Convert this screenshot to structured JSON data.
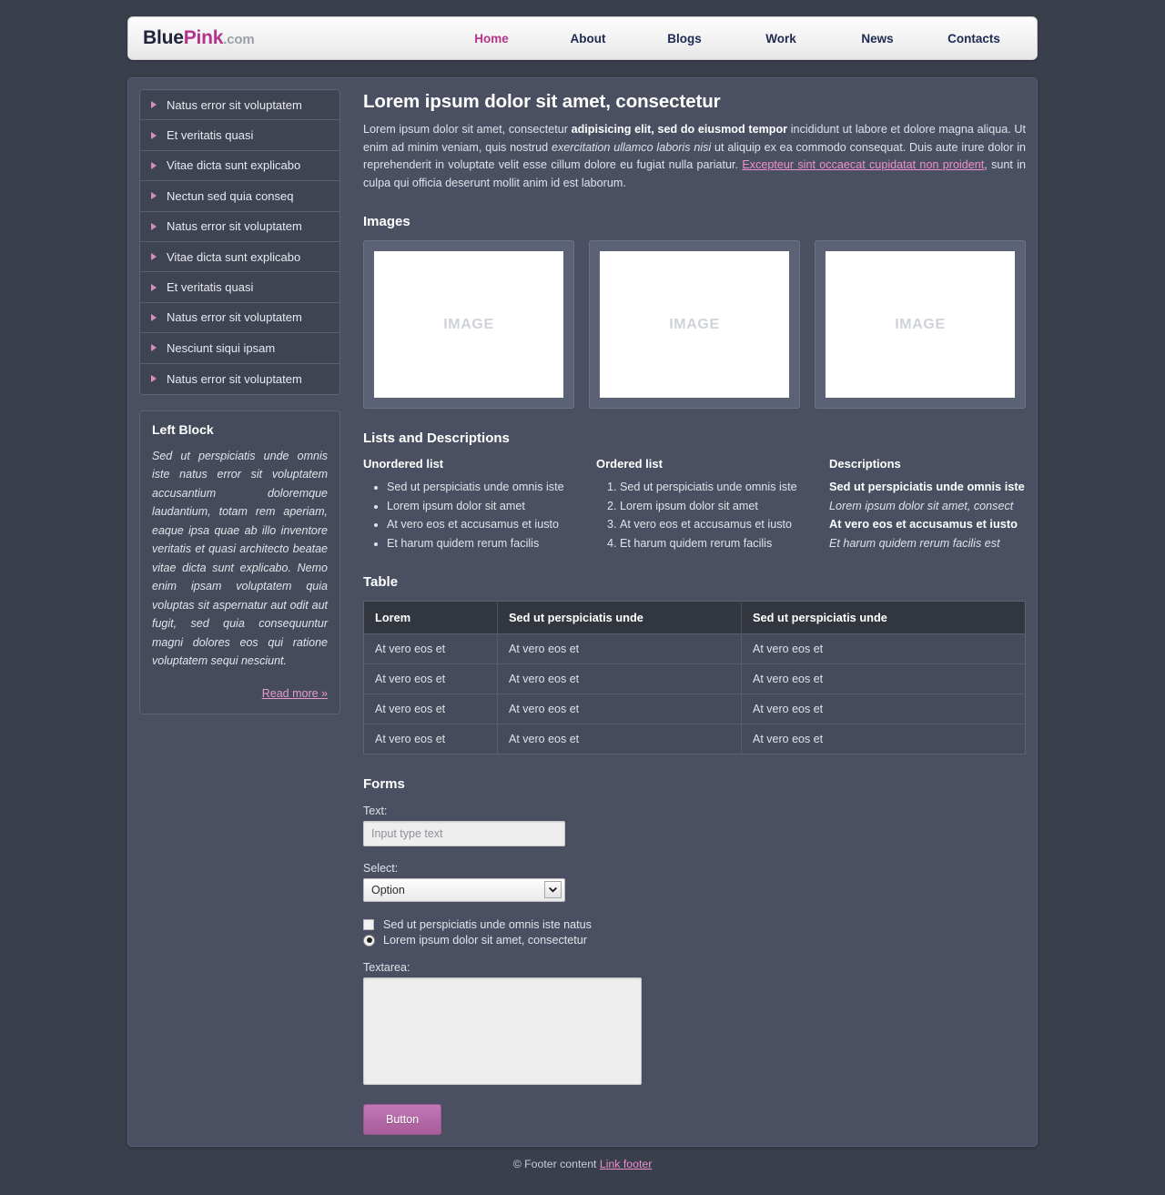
{
  "header": {
    "logo": {
      "part1": "Blue",
      "part2": "Pink",
      "part3": ".com"
    },
    "nav": [
      {
        "label": "Home",
        "active": true
      },
      {
        "label": "About",
        "active": false
      },
      {
        "label": "Blogs",
        "active": false
      },
      {
        "label": "Work",
        "active": false
      },
      {
        "label": "News",
        "active": false
      },
      {
        "label": "Contacts",
        "active": false
      }
    ]
  },
  "sidebar": {
    "menu": [
      "Natus error sit voluptatem",
      "Et veritatis quasi",
      "Vitae dicta sunt explicabo",
      "Nectun sed quia conseq",
      "Natus error sit voluptatem",
      "Vitae dicta sunt explicabo",
      "Et veritatis quasi",
      "Natus error sit voluptatem",
      "Nesciunt siqui ipsam",
      "Natus error sit voluptatem"
    ],
    "left_block": {
      "title": "Left Block",
      "text": "Sed ut perspiciatis unde omnis iste natus error sit voluptatem accusantium doloremque laudantium, totam rem aperiam, eaque ipsa quae ab illo inventore veritatis et quasi architecto beatae vitae dicta sunt explicabo. Nemo enim ipsam voluptatem quia voluptas sit aspernatur aut odit aut fugit, sed quia consequuntur magni dolores eos qui ratione voluptatem sequi nesciunt.",
      "read_more": "Read more »"
    }
  },
  "content": {
    "title": "Lorem ipsum dolor sit amet, consectetur",
    "intro": {
      "p1": "Lorem ipsum dolor sit amet, consectetur ",
      "bold": "adipisicing elit, sed do eiusmod tempor",
      "p2": " incididunt ut labore et dolore magna aliqua. Ut enim ad minim veniam, quis nostrud ",
      "italic": "exercitation ullamco laboris nisi",
      "p3": " ut aliquip ex ea commodo consequat. Duis aute irure dolor in reprehenderit in voluptate velit esse cillum dolore eu fugiat nulla pariatur. ",
      "link": "Excepteur sint occaecat cupidatat non proident",
      "p4": ", sunt in culpa qui officia deserunt mollit anim id est laborum."
    },
    "images": {
      "heading": "Images",
      "items": [
        {
          "placeholder": "IMAGE"
        },
        {
          "placeholder": "IMAGE"
        },
        {
          "placeholder": "IMAGE"
        }
      ]
    },
    "lists": {
      "heading": "Lists and Descriptions",
      "unordered": {
        "title": "Unordered list",
        "items": [
          "Sed ut perspiciatis unde omnis iste",
          "Lorem ipsum dolor sit amet",
          "At vero eos et accusamus et iusto",
          "Et harum quidem rerum facilis"
        ]
      },
      "ordered": {
        "title": "Ordered list",
        "items": [
          "Sed ut perspiciatis unde omnis iste",
          "Lorem ipsum dolor sit amet",
          "At vero eos et accusamus et iusto",
          "Et harum quidem rerum facilis"
        ]
      },
      "descriptions": {
        "title": "Descriptions",
        "items": [
          {
            "term": "Sed ut perspiciatis unde omnis iste",
            "def": "Lorem ipsum dolor sit amet, consect"
          },
          {
            "term": "At vero eos et accusamus et iusto",
            "def": "Et harum quidem rerum facilis est"
          }
        ]
      }
    },
    "table": {
      "heading": "Table",
      "columns": [
        "Lorem",
        "Sed ut perspiciatis unde",
        "Sed ut perspiciatis unde"
      ],
      "rows": [
        [
          "At vero eos et",
          "At vero eos et",
          "At vero eos et"
        ],
        [
          "At vero eos et",
          "At vero eos et",
          "At vero eos et"
        ],
        [
          "At vero eos et",
          "At vero eos et",
          "At vero eos et"
        ],
        [
          "At vero eos et",
          "At vero eos et",
          "At vero eos et"
        ]
      ]
    },
    "forms": {
      "heading": "Forms",
      "text_label": "Text:",
      "text_placeholder": "Input type text",
      "text_value": "",
      "select_label": "Select:",
      "select_value": "Option",
      "checkbox_label": "Sed ut perspiciatis unde omnis iste natus",
      "checkbox_checked": false,
      "radio_label": "Lorem ipsum dolor sit amet, consectetur",
      "radio_checked": true,
      "textarea_label": "Textarea:",
      "textarea_value": "",
      "button_label": "Button"
    }
  },
  "footer": {
    "text": "© Footer content ",
    "link": "Link footer"
  },
  "colors": {
    "page_bg": "#3a3f4c",
    "container_bg": "#4a5061",
    "accent_pink": "#b4338c",
    "nav_blue": "#1d2a52",
    "link_pink": "#ef8fd0",
    "table_header": "#32363f",
    "button": "#b56aa8"
  }
}
